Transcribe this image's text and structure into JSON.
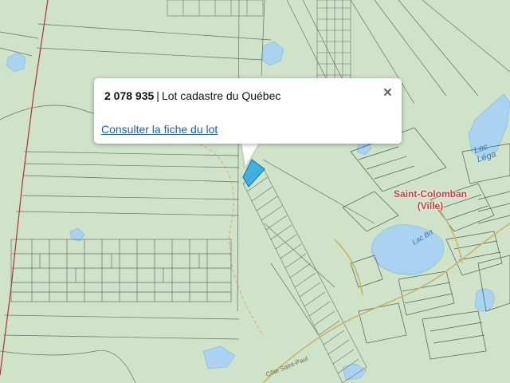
{
  "popup": {
    "lot_number": "2 078 935",
    "separator": "|",
    "title": "Lot cadastre du Québec",
    "link_text": "Consulter la fiche du lot",
    "close_symbol": "×"
  },
  "map": {
    "town_label_line1": "Saint-Colomban",
    "town_label_line2": "(Ville)",
    "lake_label_1": "Lac Léga",
    "lake_label_2": "Lac Brt",
    "road_label": "Côte Saint-Paul",
    "colors": {
      "land": "#cfe3c9",
      "water": "#a9d3f0",
      "parcel_line": "#6e6e6e",
      "selected_lot": "#2aa8e0",
      "boundary": "#b03030",
      "road": "#c8b46a"
    }
  }
}
